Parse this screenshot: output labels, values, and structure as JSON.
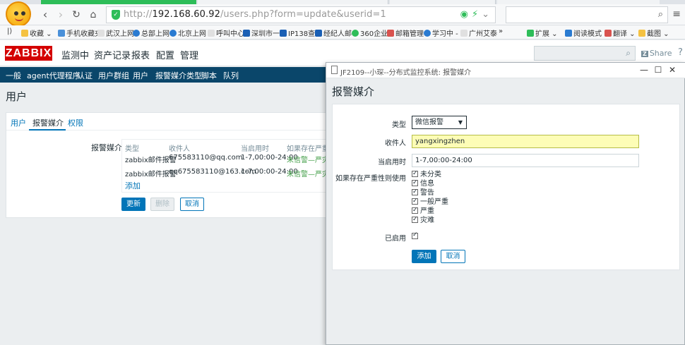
{
  "browser": {
    "url_prefix": "http://",
    "url_host": "192.168.60.92",
    "url_path": "/users.php?form=update&userid=1",
    "bookmarks_label": "收藏",
    "bookmarks": [
      "手机收藏夹",
      "武汉上网",
      "总部上网",
      "北京上网",
      "呼叫中心",
      "深圳市一",
      "IP138查",
      "经纪人邮",
      "360企业",
      "邮箱管理",
      "学习中 -",
      "广州艾泰",
      "»"
    ],
    "right_tools": [
      "扩展",
      "阅读模式",
      "翻译",
      "截图"
    ],
    "colors": {
      "accent": "#2ebd59"
    }
  },
  "zabbix": {
    "logo": "ZABBIX",
    "menu": [
      "监测中",
      "资产记录",
      "报表",
      "配置",
      "管理"
    ],
    "share": "Share",
    "share_badge": "Z",
    "help": "?",
    "submenu": [
      "一般",
      "agent代理程序",
      "认证",
      "用户群组",
      "用户",
      "报警媒介类型",
      "脚本",
      "队列"
    ],
    "page_title": "用户",
    "tabs": [
      "用户",
      "报警媒介",
      "权限"
    ],
    "form_label": "报警媒介",
    "table": {
      "headers": [
        "类型",
        "收件人",
        "当启用时",
        "如果存在严重性"
      ],
      "rows": [
        [
          "zabbix邮件报警",
          "675583110@qq.com",
          "1-7,00:00-24:00",
          "未信警—严灾"
        ],
        [
          "zabbix邮件报警",
          "qq675583110@163.com",
          "1-7,00:00-24:00",
          "未信警—严灾"
        ]
      ],
      "add_link": "添加"
    },
    "buttons": {
      "update": "更新",
      "delete": "删除",
      "cancel": "取消"
    },
    "colors": {
      "brand_red": "#d40000",
      "nav_blue": "#0a466a",
      "link": "#0275b8",
      "green": "#429e47"
    }
  },
  "modal": {
    "window_title": "JF2109--小琛--分布式监控系统: 报警媒介",
    "heading": "报警媒介",
    "controls": {
      "minimize": "—",
      "maximize": "☐",
      "close": "✕"
    },
    "fields": {
      "type_label": "类型",
      "type_value": "微信报警",
      "sendto_label": "收件人",
      "sendto_value": "yangxingzhen",
      "period_label": "当启用时",
      "period_value": "1-7,00:00-24:00",
      "severity_label": "如果存在严重性则使用",
      "severities": [
        "未分类",
        "信息",
        "警告",
        "一般严重",
        "严重",
        "灾难"
      ],
      "enabled_label": "已启用"
    },
    "buttons": {
      "add": "添加",
      "cancel": "取消"
    }
  }
}
